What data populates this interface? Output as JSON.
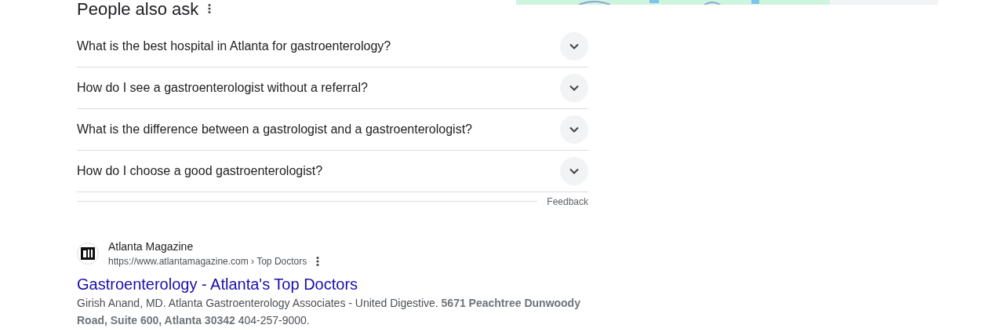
{
  "people_also_ask": {
    "title": "People also ask",
    "questions": [
      {
        "text": "What is the best hospital in Atlanta for gastroenterology?",
        "expanded": false
      },
      {
        "text": "How do I see a gastroenterologist without a referral?",
        "expanded": false
      },
      {
        "text": "What is the difference between a gastrologist and a gastroenterologist?",
        "expanded": false
      },
      {
        "text": "How do I choose a good gastroenterologist?",
        "expanded": false
      }
    ],
    "feedback": "Feedback"
  },
  "result": {
    "site_name": "Atlanta Magazine",
    "url": "https://www.atlantamagazine.com › Top Doctors",
    "title": "Gastroenterology - Atlanta's Top Doctors",
    "snippet": "Girish Anand, MD. Atlanta Gastroenterology Associates - United Digestive. **5671 Peachtree Dunwoody Road, Suite 600, Atlanta 30342** 404-257-9000."
  }
}
